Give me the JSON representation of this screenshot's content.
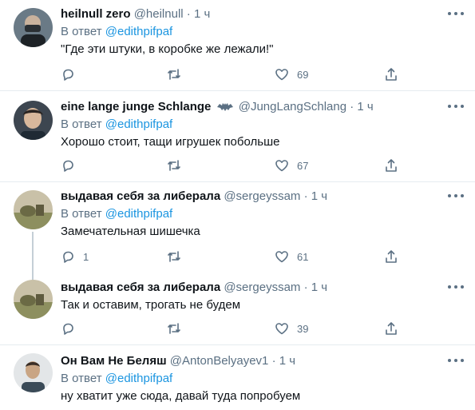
{
  "tweets": [
    {
      "name": "heilnull zero",
      "handle": "@heilnull",
      "dot": "·",
      "time": "1 ч",
      "reply_prefix": "В ответ",
      "reply_to": "@edithpifpaf",
      "text": "\"Где эти штуки, в коробке же лежали!\"",
      "replies": "",
      "retweets": "",
      "likes": "69"
    },
    {
      "name": "eine lange junge Schlange",
      "handle": "@JungLangSchlang",
      "dot": "·",
      "time": "1 ч",
      "reply_prefix": "В ответ",
      "reply_to": "@edithpifpaf",
      "text": "Хорошо стоит, тащи игрушек побольше",
      "replies": "",
      "retweets": "",
      "likes": "67"
    },
    {
      "name": "выдавая себя за либерала",
      "handle": "@sergeyssam",
      "dot": "·",
      "time": "1 ч",
      "reply_prefix": "В ответ",
      "reply_to": "@edithpifpaf",
      "text": "Замечательная шишечка",
      "replies": "1",
      "retweets": "",
      "likes": "61"
    },
    {
      "name": "выдавая себя за либерала",
      "handle": "@sergeyssam",
      "dot": "·",
      "time": "1 ч",
      "text": "Так и оставим, трогать не будем",
      "replies": "",
      "retweets": "",
      "likes": "39"
    },
    {
      "name": "Он Вам Не Беляш",
      "handle": "@AntonBelyayev1",
      "dot": "·",
      "time": "1 ч",
      "reply_prefix": "В ответ",
      "reply_to": "@edithpifpaf",
      "text": "ну хватит уже сюда, давай туда попробуем"
    }
  ],
  "icons": {
    "reply": "reply-icon",
    "retweet": "retweet-icon",
    "like": "heart-icon",
    "share": "share-icon",
    "more": "more-icon",
    "badge": "bat-icon"
  },
  "colors": {
    "link": "#1b95e0",
    "muted": "#5b7083",
    "separator": "#e6ecf0"
  }
}
